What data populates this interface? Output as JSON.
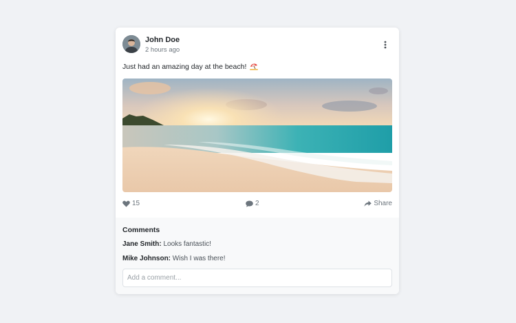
{
  "post": {
    "author": "John Doe",
    "timestamp": "2 hours ago",
    "text": "Just had an amazing day at the beach!",
    "likes": "15",
    "comments_count": "2",
    "share_label": "Share"
  },
  "comments": {
    "title": "Comments",
    "items": [
      {
        "author": "Jane Smith:",
        "text": "Looks fantastic!"
      },
      {
        "author": "Mike Johnson:",
        "text": "Wish I was there!"
      }
    ],
    "placeholder": "Add a comment..."
  },
  "icons": {
    "more": "vertical-ellipsis-icon",
    "like": "heart-icon",
    "comment": "speech-bubble-icon",
    "share": "share-arrow-icon",
    "emoji": "beach-umbrella-icon"
  },
  "colors": {
    "background": "#f0f2f5",
    "card": "#ffffff",
    "comments_background": "#f8f9fa",
    "muted_text": "#6c757d"
  }
}
